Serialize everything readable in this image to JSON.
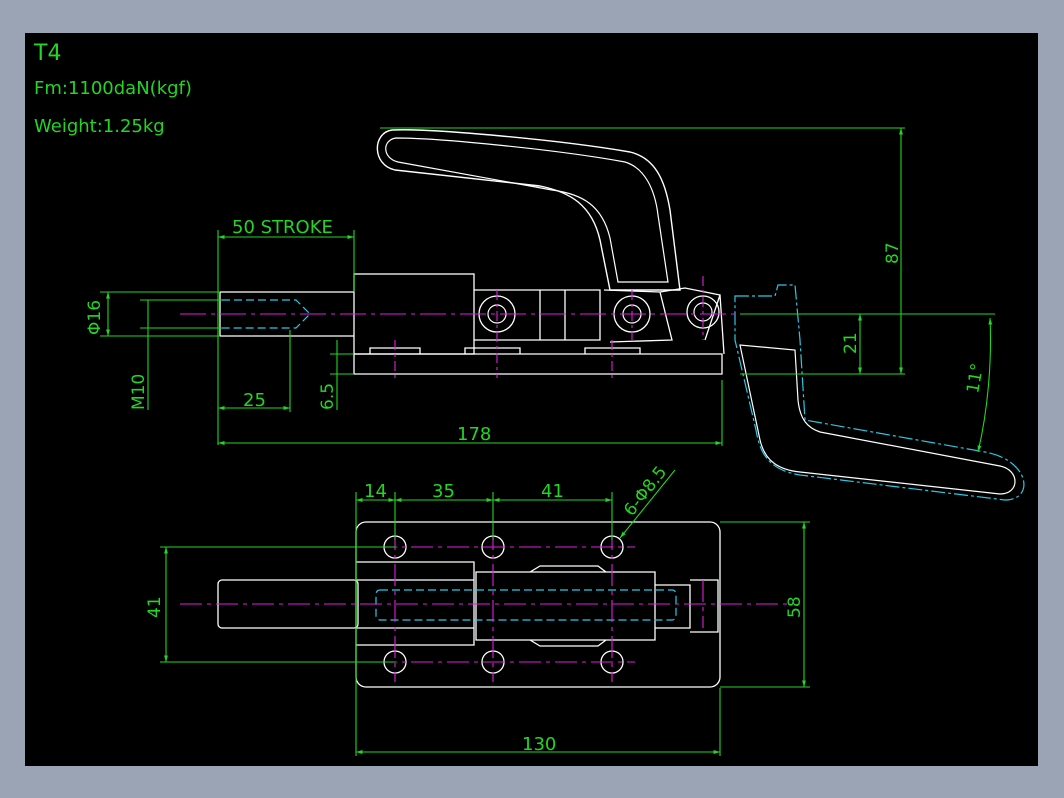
{
  "drawing": {
    "title": "T4",
    "force": "Fm:1100daN(kgf)",
    "weight": "Weight:1.25kg"
  },
  "dimensions": {
    "stroke": "50 STROKE",
    "dia16": "Φ16",
    "m10": "M10",
    "d25": "25",
    "d6_5": "6.5",
    "d178": "178",
    "d87": "87",
    "d21": "21",
    "angle11": "11°",
    "d14": "14",
    "d35": "35",
    "d41_top": "41",
    "holes": "6-Φ8.5",
    "d41_left": "41",
    "d58": "58",
    "d130": "130"
  },
  "colors": {
    "background": "#000000",
    "outline": "#ffffff",
    "dimension": "#22d622",
    "centerline": "#e01ee0",
    "hidden": "#2ac8e6",
    "frame": "#9aa4b4"
  }
}
